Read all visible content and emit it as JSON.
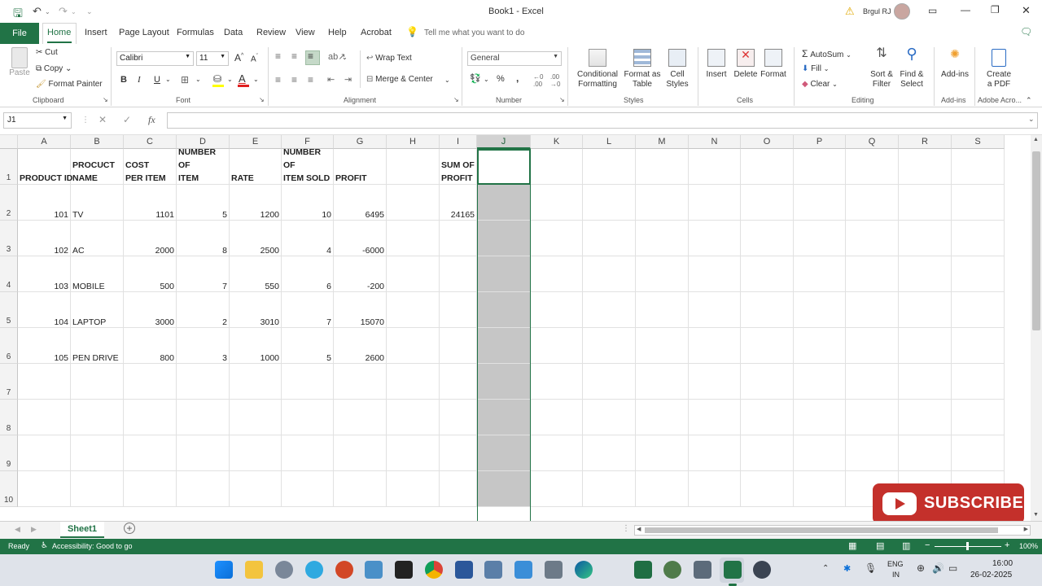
{
  "window": {
    "title": "Book1  -  Excel",
    "user_name": "Brgul RJ",
    "minimize": "—",
    "restore": "❐",
    "close": "✕"
  },
  "tabs": [
    "File",
    "Home",
    "Insert",
    "Page Layout",
    "Formulas",
    "Data",
    "Review",
    "View",
    "Help",
    "Acrobat"
  ],
  "tell_me": "Tell me what you want to do",
  "ribbon": {
    "clipboard": {
      "paste": "Paste",
      "cut": "Cut",
      "copy": "Copy",
      "format_painter": "Format Painter",
      "label": "Clipboard"
    },
    "font": {
      "name": "Calibri",
      "size": "11",
      "bold": "B",
      "italic": "I",
      "underline": "U",
      "label": "Font"
    },
    "alignment": {
      "wrap": "Wrap Text",
      "merge": "Merge & Center",
      "label": "Alignment"
    },
    "number": {
      "format": "General",
      "percent": "%",
      "comma": ",",
      "label": "Number"
    },
    "styles": {
      "conditional": "Conditional Formatting",
      "format_table": "Format as Table",
      "cell_styles": "Cell Styles",
      "label": "Styles"
    },
    "cells": {
      "insert": "Insert",
      "delete": "Delete",
      "format": "Format",
      "label": "Cells"
    },
    "editing": {
      "autosum": "AutoSum",
      "fill": "Fill",
      "clear": "Clear",
      "sort": "Sort & Filter",
      "find": "Find & Select",
      "label": "Editing"
    },
    "addins": {
      "addins": "Add-ins",
      "label": "Add-ins"
    },
    "adobe": {
      "create": "Create a PDF",
      "label": "Adobe Acro..."
    }
  },
  "formula_bar": {
    "name_box": "J1",
    "fx": "fx",
    "content": ""
  },
  "columns": [
    "A",
    "B",
    "C",
    "D",
    "E",
    "F",
    "G",
    "H",
    "I",
    "J",
    "K",
    "L",
    "M",
    "N",
    "O",
    "P",
    "Q",
    "R",
    "S"
  ],
  "rows": [
    "1",
    "2",
    "3",
    "4",
    "5",
    "6",
    "7",
    "8",
    "9",
    "10"
  ],
  "header_row": {
    "A": [
      "PRODUCT ID"
    ],
    "B": [
      "PROCUCT",
      "NAME"
    ],
    "C": [
      "COST",
      "PER ITEM"
    ],
    "D": [
      "NUMBER",
      "OF",
      "ITEM"
    ],
    "E": [
      "RATE"
    ],
    "F": [
      "NUMBER",
      "OF",
      "ITEM SOLD"
    ],
    "G": [
      "PROFIT"
    ],
    "I": [
      "SUM OF",
      "PROFIT"
    ]
  },
  "table": [
    {
      "id": "101",
      "name": "TV",
      "cost": "1101",
      "items": "5",
      "rate": "1200",
      "sold": "10",
      "profit": "6495",
      "sum": "24165"
    },
    {
      "id": "102",
      "name": "AC",
      "cost": "2000",
      "items": "8",
      "rate": "2500",
      "sold": "4",
      "profit": "-6000",
      "sum": ""
    },
    {
      "id": "103",
      "name": "MOBILE",
      "cost": "500",
      "items": "7",
      "rate": "550",
      "sold": "6",
      "profit": "-200",
      "sum": ""
    },
    {
      "id": "104",
      "name": "LAPTOP",
      "cost": "3000",
      "items": "2",
      "rate": "3010",
      "sold": "7",
      "profit": "15070",
      "sum": ""
    },
    {
      "id": "105",
      "name": "PEN DRIVE",
      "cost": "800",
      "items": "3",
      "rate": "1000",
      "sold": "5",
      "profit": "2600",
      "sum": ""
    }
  ],
  "sheet_tab": "Sheet1",
  "status": {
    "ready": "Ready",
    "accessibility": "Accessibility: Good to go",
    "zoom": "100%"
  },
  "subscribe": "SUBSCRIBE",
  "taskbar": {
    "lang1": "ENG",
    "lang2": "IN",
    "time": "16:00",
    "date": "26-02-2025"
  },
  "colors": {
    "excel_green": "#217346",
    "selected_col": "#c6c6c6",
    "subscribe_red": "#c4302b"
  }
}
